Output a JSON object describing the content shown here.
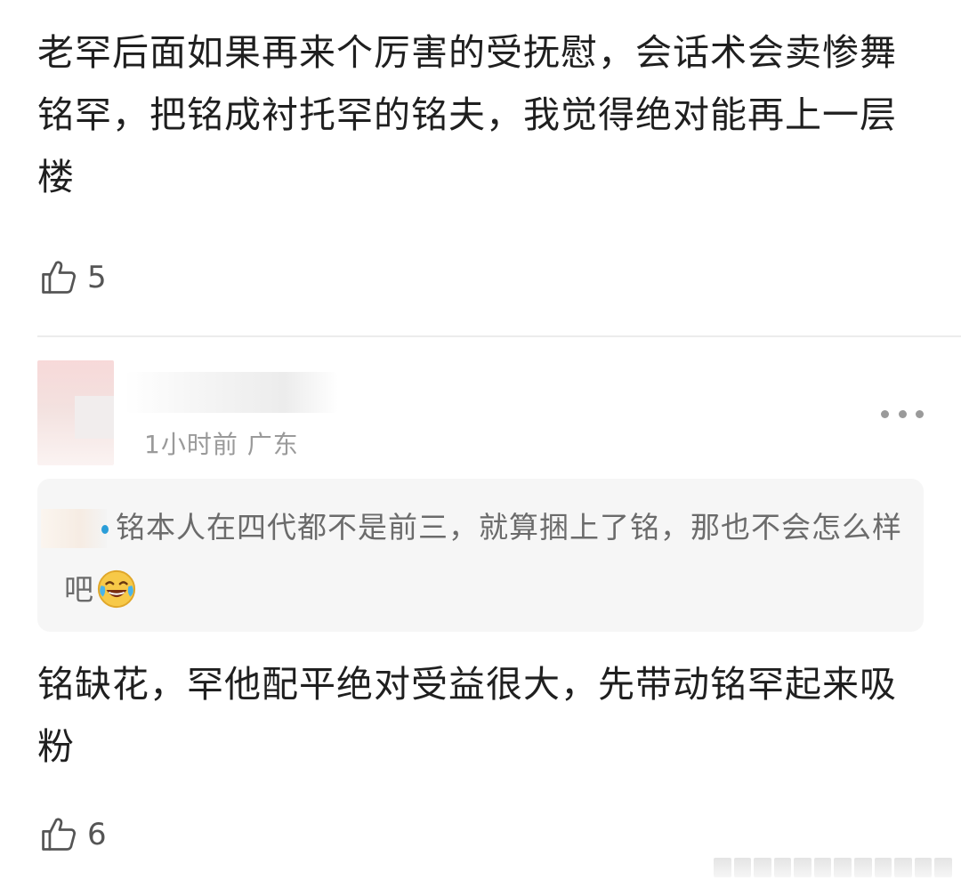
{
  "comments": [
    {
      "text": "老罕后面如果再来个厉害的受抚慰，会话术会卖惨舞铭罕，把铭成衬托罕的铭夫，我觉得绝对能再上一层楼",
      "likes": "5"
    },
    {
      "meta": "1小时前 广东",
      "quote": {
        "text": "铭本人在四代都不是前三，就算捆上了铭，那也不会怎么样吧",
        "emoji": "laughing-tears-emoji"
      },
      "text": "铭缺花，罕他配平绝对受益很大，先带动铭罕起来吸粉",
      "likes": "6"
    }
  ],
  "icons": {
    "like": "thumbs-up-icon",
    "more": "more-dots-icon"
  },
  "colors": {
    "text": "#1f1f1f",
    "meta": "#9a9a9a",
    "quote_bg": "#f6f6f6",
    "quote_text": "#6b6b6b",
    "divider": "#ececec"
  }
}
